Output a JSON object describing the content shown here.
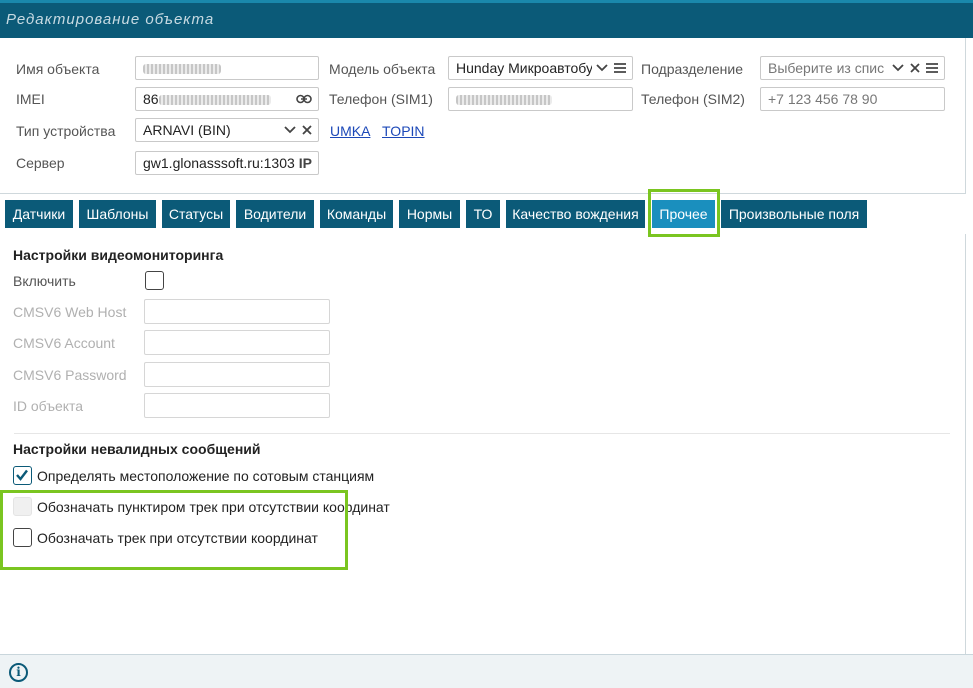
{
  "window": {
    "title": "Редактирование объекта"
  },
  "form": {
    "object_name": {
      "label": "Имя объекта",
      "value": ""
    },
    "imei": {
      "label": "IMEI",
      "value": "86"
    },
    "device_type": {
      "label": "Тип устройства",
      "value": "ARNAVI (BIN)"
    },
    "server": {
      "label": "Сервер",
      "value": "gw1.glonasssoft.ru:1303",
      "tag": "IP"
    },
    "object_model": {
      "label": "Модель объекта",
      "value": "Hunday Микроавтобу"
    },
    "phone_sim1": {
      "label": "Телефон (SIM1)",
      "value": ""
    },
    "division": {
      "label": "Подразделение",
      "placeholder": "Выберите из спис"
    },
    "phone_sim2": {
      "label": "Телефон (SIM2)",
      "placeholder": "+7 123 456 78 90"
    },
    "links": [
      "UMKA",
      "TOPIN"
    ]
  },
  "tabs": [
    {
      "label": "Датчики"
    },
    {
      "label": "Шаблоны"
    },
    {
      "label": "Статусы"
    },
    {
      "label": "Водители"
    },
    {
      "label": "Команды"
    },
    {
      "label": "Нормы"
    },
    {
      "label": "ТО"
    },
    {
      "label": "Качество вождения"
    },
    {
      "label": "Прочее",
      "active": true
    },
    {
      "label": "Произвольные поля"
    }
  ],
  "video": {
    "heading": "Настройки видеомониторинга",
    "enable_label": "Включить",
    "fields": [
      "CMSV6 Web Host",
      "CMSV6 Account",
      "CMSV6 Password",
      "ID объекта"
    ]
  },
  "invalid": {
    "heading": "Настройки невалидных сообщений",
    "options": [
      {
        "label": "Определять местоположение по сотовым станциям",
        "checked": true,
        "disabled": false
      },
      {
        "label": "Обозначать пунктиром трек при отсутствии координат",
        "checked": false,
        "disabled": true
      },
      {
        "label": "Обозначать трек при отсутствии координат",
        "checked": false,
        "disabled": false
      }
    ]
  },
  "colors": {
    "primary": "#0b5a78",
    "active_tab": "#1a8fbe",
    "highlight": "#7ac520",
    "link": "#1c48b8"
  },
  "icons": {
    "dropdown": "chevron-down-icon",
    "list": "list-icon",
    "clear": "close-icon",
    "link": "link-icon",
    "info": "info-icon"
  },
  "footer": {
    "info_glyph": "i"
  }
}
